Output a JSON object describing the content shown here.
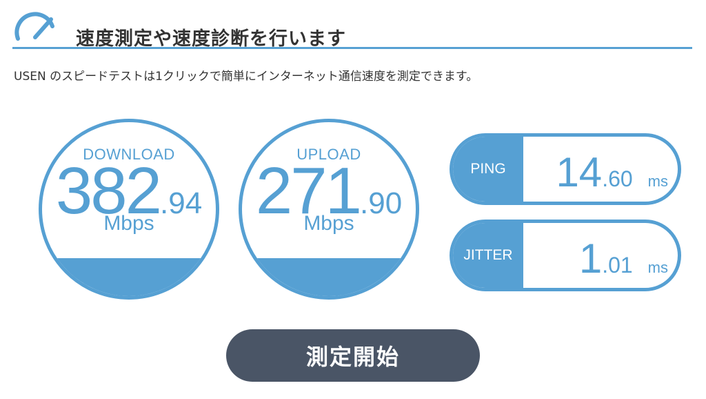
{
  "header": {
    "title": "速度測定や速度診断を行います",
    "icon": "speedometer-icon"
  },
  "intro": "USEN のスピードテストは1クリックで簡単にインターネット通信速度を測定できます。",
  "download": {
    "label": "DOWNLOAD",
    "value_int": "382",
    "value_dec": ".94",
    "unit": "Mbps",
    "fill_fraction": 0.22
  },
  "upload": {
    "label": "UPLOAD",
    "value_int": "271",
    "value_dec": ".90",
    "unit": "Mbps",
    "fill_fraction": 0.22
  },
  "ping": {
    "label": "PING",
    "value_int": "14",
    "value_dec": ".60",
    "unit": "ms"
  },
  "jitter": {
    "label": "JITTER",
    "value_int": "1",
    "value_dec": ".01",
    "unit": "ms"
  },
  "start_button": {
    "label": "測定開始"
  },
  "colors": {
    "accent": "#56a0d3",
    "button": "#4a5566",
    "text": "#333333"
  }
}
